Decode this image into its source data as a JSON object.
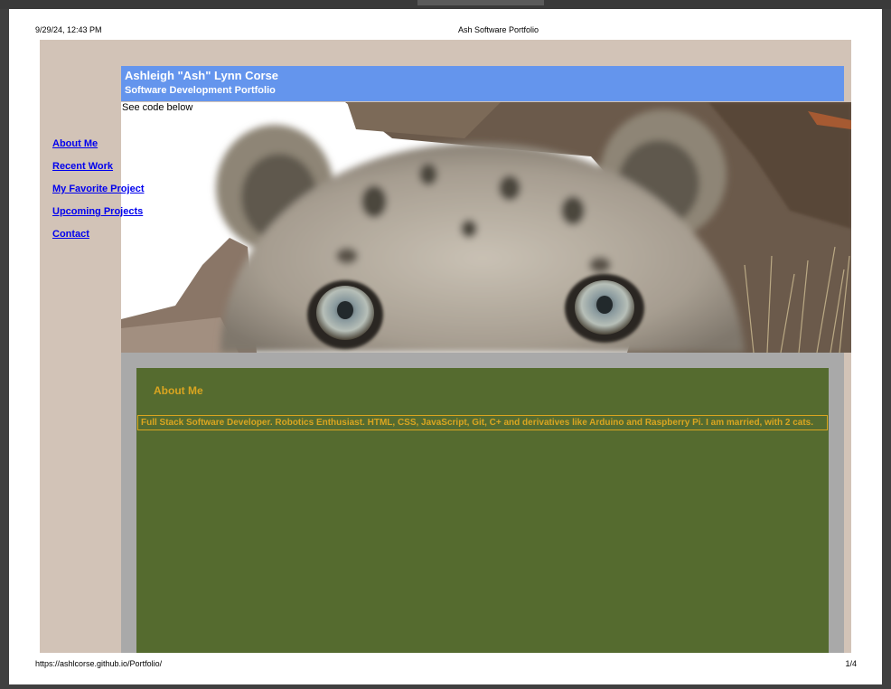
{
  "print": {
    "datetime": "9/29/24, 12:43 PM",
    "doc_title": "Ash Software Portfolio",
    "url": "https://ashlcorse.github.io/Portfolio/",
    "page_number": "1/4"
  },
  "header": {
    "name": "Ashleigh \"Ash\" Lynn Corse",
    "subtitle": "Software Development Portfolio",
    "bg_color": "#6495ed"
  },
  "hero": {
    "caption": "See code below",
    "image_subject": "snow-leopard-peeking"
  },
  "nav": {
    "items": [
      {
        "label": "About Me"
      },
      {
        "label": "Recent Work"
      },
      {
        "label": "My Favorite Project"
      },
      {
        "label": "Upcoming Projects"
      },
      {
        "label": "Contact"
      }
    ]
  },
  "about": {
    "title": "About Me",
    "text": "Full Stack Software Developer. Robotics Enthusiast. HTML, CSS, JavaScript, Git, C+ and derivatives like Arduino and Raspberry Pi. I am married, with 2 cats.",
    "panel_color": "#556b2f",
    "text_color": "#daa520"
  },
  "colors": {
    "page_bg": "#d2c3b7",
    "content_frame": "#a9a9a9"
  }
}
